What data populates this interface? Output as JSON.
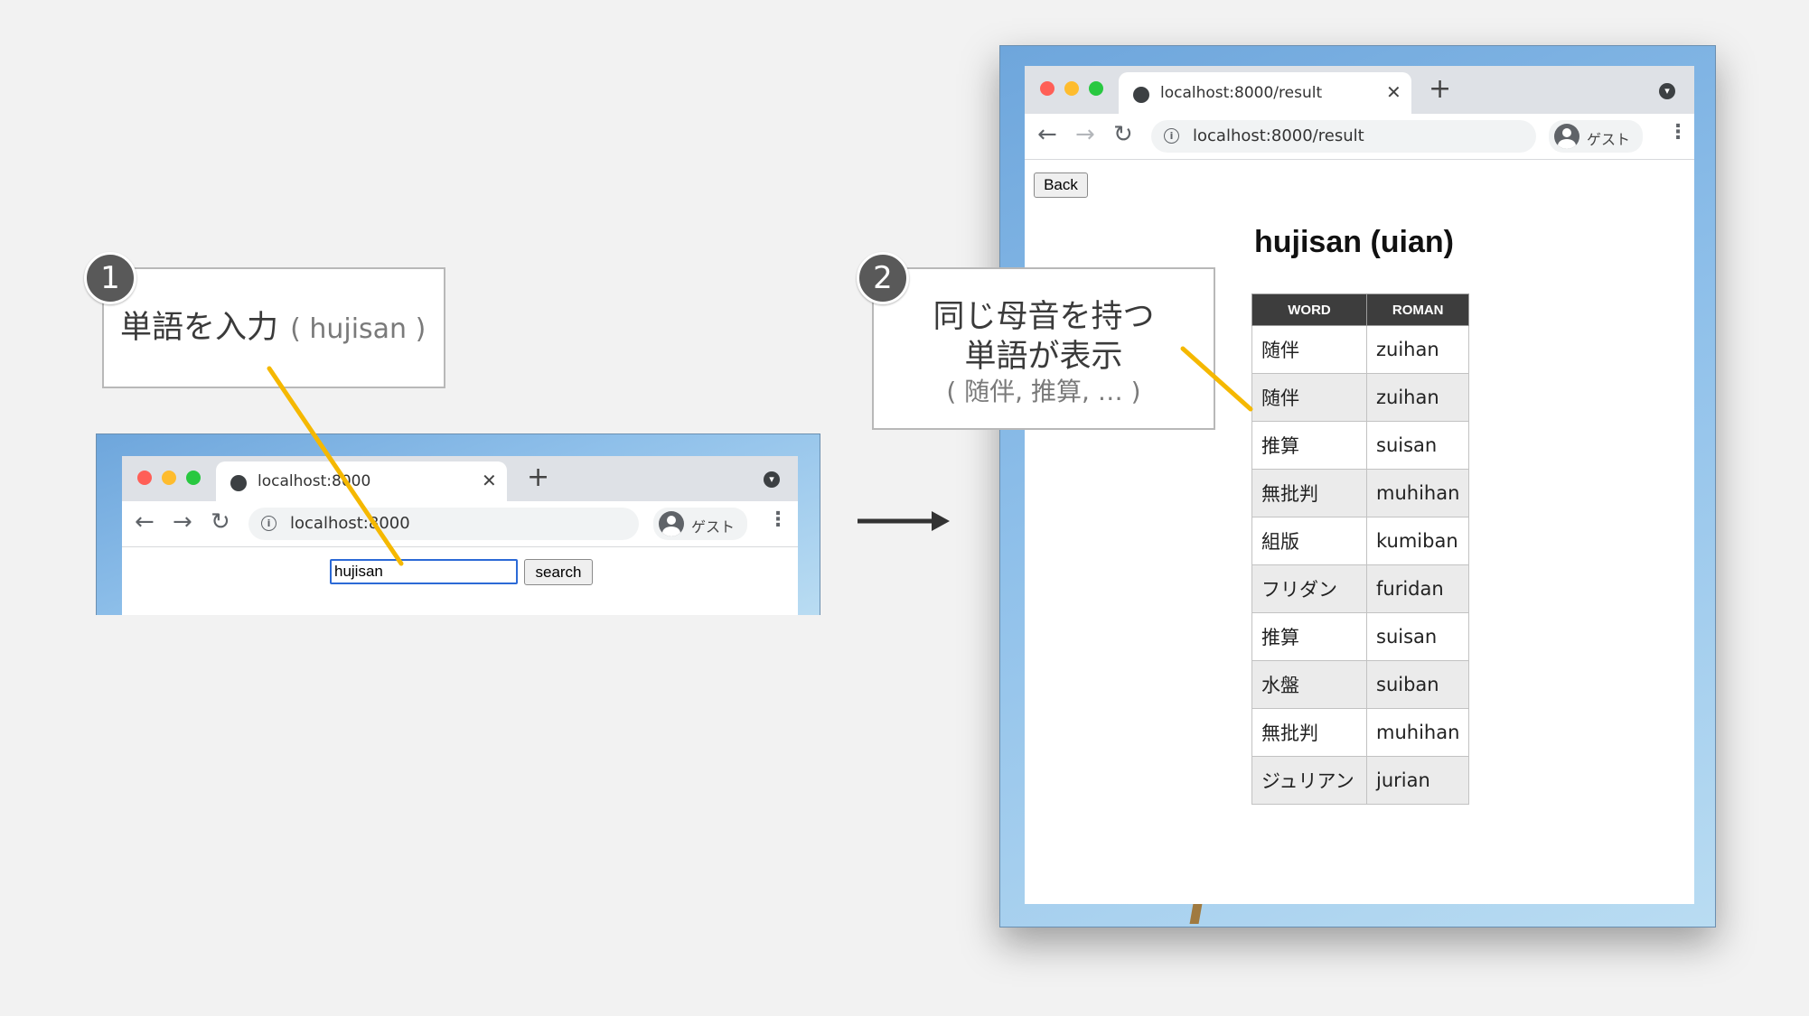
{
  "step1": {
    "badge": "1",
    "text": "単語を入力",
    "example": "( hujisan )"
  },
  "step2": {
    "badge": "2",
    "line1": "同じ母音を持つ",
    "line2": "単語が表示",
    "example": "( 随伴, 推算, … )"
  },
  "browser1": {
    "tab_title": "localhost:8000",
    "url": "localhost:8000",
    "profile_label": "ゲスト",
    "search_value": "hujisan",
    "search_button": "search"
  },
  "browser2": {
    "tab_title": "localhost:8000/result",
    "url": "localhost:8000/result",
    "profile_label": "ゲスト",
    "back_button": "Back",
    "heading": "hujisan (uian)",
    "table": {
      "headers": [
        "WORD",
        "ROMAN"
      ],
      "rows": [
        {
          "word": "随伴",
          "roman": "zuihan"
        },
        {
          "word": "随伴",
          "roman": "zuihan"
        },
        {
          "word": "推算",
          "roman": "suisan"
        },
        {
          "word": "無批判",
          "roman": "muhihan"
        },
        {
          "word": "組版",
          "roman": "kumiban"
        },
        {
          "word": "フリダン",
          "roman": "furidan"
        },
        {
          "word": "推算",
          "roman": "suisan"
        },
        {
          "word": "水盤",
          "roman": "suiban"
        },
        {
          "word": "無批判",
          "roman": "muhihan"
        },
        {
          "word": "ジュリアン",
          "roman": "jurian"
        }
      ]
    }
  },
  "colors": {
    "accent_line": "#f5b800",
    "traffic_red": "#ff5f57",
    "traffic_yellow": "#febc2e",
    "traffic_green": "#28c840",
    "table_header_bg": "#3d3d3d",
    "badge_bg": "#595959"
  },
  "icons": {
    "back": "arrow-left-icon",
    "forward": "arrow-right-icon",
    "reload": "reload-icon",
    "info": "info-icon",
    "profile": "avatar-icon",
    "menu": "kebab-icon",
    "tab_favicon": "globe-icon",
    "flow": "arrow-right-icon"
  }
}
